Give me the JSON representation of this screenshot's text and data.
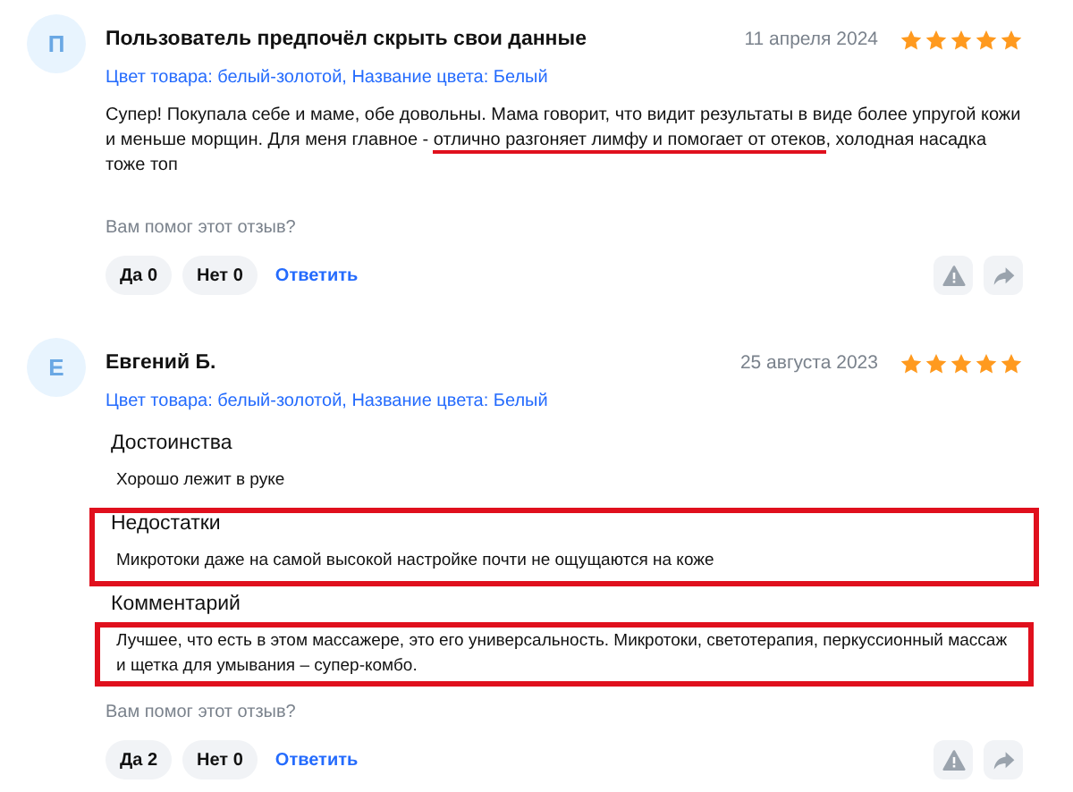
{
  "reviews": [
    {
      "avatar": "П",
      "author": "Пользователь предпочёл скрыть свои данные",
      "date": "11 апреля 2024",
      "stars": 5,
      "variant": "Цвет товара: белый-золотой, Название цвета: Белый",
      "text": [
        {
          "text": "Супер! Покупала себе и маме, обе довольны. Мама говорит, что видит результаты в виде более упругой кожи и меньше морщин. Для меня главное - ",
          "underlined": false
        },
        {
          "text": "отлично разгоняет лимфу и помогает от отеков",
          "underlined": true
        },
        {
          "text": ", холодная насадка тоже топ",
          "underlined": false
        }
      ],
      "helpful_question": "Вам помог этот отзыв?",
      "yes": "Да 0",
      "no": "Нет 0",
      "reply": "Ответить"
    },
    {
      "avatar": "Е",
      "author": "Евгений Б.",
      "date": "25 августа 2023",
      "stars": 5,
      "variant": "Цвет товара: белый-золотой, Название цвета: Белый",
      "sections": [
        {
          "title": "Достоинства",
          "text": "Хорошо лежит в руке",
          "framed": false,
          "text_framed": false
        },
        {
          "title": "Недостатки",
          "text": "Микротоки даже на самой высокой настройке почти не ощущаются на коже",
          "framed": true,
          "text_framed": false
        },
        {
          "title": "Комментарий",
          "text": "Лучшее, что есть в этом массажере, это его универсальность. Микротоки, светотерапия, перкуссионный массаж и щетка для умывания – супер-комбо.",
          "framed": false,
          "text_framed": true
        }
      ],
      "helpful_question": "Вам помог этот отзыв?",
      "yes": "Да 2",
      "no": "Нет 0",
      "reply": "Ответить"
    }
  ]
}
